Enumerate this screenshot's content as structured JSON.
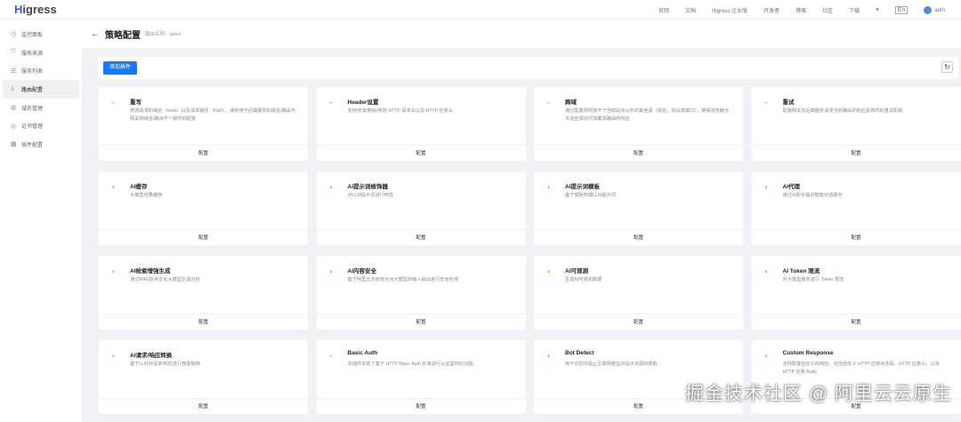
{
  "app": {
    "logo": "Higress"
  },
  "topnav": [
    "官网",
    "文档",
    "Higress 企业版",
    "开发者",
    "博客",
    "社区",
    "下载"
  ],
  "lang": "En",
  "user": "adm",
  "sidebar": [
    {
      "icon": "◷",
      "label": "监控面板"
    },
    {
      "icon": "⤧",
      "label": "服务来源"
    },
    {
      "icon": "☰",
      "label": "服务列表"
    },
    {
      "icon": "⅄",
      "label": "路由配置",
      "active": true
    },
    {
      "icon": "◍",
      "label": "域名管理"
    },
    {
      "icon": "◎",
      "label": "证书管理"
    },
    {
      "icon": "▦",
      "label": "插件配置"
    }
  ],
  "page": {
    "title": "策略配置",
    "subtitle": "路由名称：qwen",
    "add_label": "添加插件",
    "refresh": "↻"
  },
  "cards": [
    {
      "title": "重写",
      "desc": "修改请求的域名（Host）以及请求路径（Path），通常用于后端服务的域名/路由与网关侧域名/路由不一致时的配置",
      "type": "plug"
    },
    {
      "title": "Header设置",
      "desc": "支持增加/删除/修改 HTTP 请求头以及 HTTP 应答头",
      "type": "plug"
    },
    {
      "title": "跨域",
      "desc": "通过配置规则放开了当前站点以外的其他源（域名、协议或端口），使得浏览器允许这些源访问加载该路由的响应",
      "type": "plug"
    },
    {
      "title": "重试",
      "desc": "配置网关向后端服务请求当前路由的响应失败时的重试机制",
      "type": "plug"
    },
    {
      "title": "AI缓存",
      "desc": "大模型结果缓存",
      "type": "ai"
    },
    {
      "title": "AI提示词修饰器",
      "desc": "对LLM提示词进行修改",
      "type": "ai"
    },
    {
      "title": "AI提示词模板",
      "desc": "基于模板构建LLM提示词",
      "type": "ai"
    },
    {
      "title": "AI代理",
      "desc": "通过AI助手提供智能对话服务",
      "type": "ai"
    },
    {
      "title": "AI检索增强生成",
      "desc": "通过RAG技术优化大模型生成内容",
      "type": "ai"
    },
    {
      "title": "AI内容安全",
      "desc": "基于阿里云内容安全对大模型的输入输出进行安全检测",
      "type": "ai"
    },
    {
      "title": "AI可观测",
      "desc": "生成AI可观测数据",
      "type": "ai"
    },
    {
      "title": "AI Token 限流",
      "desc": "对大模型服务进行 Token 限流",
      "type": "ai"
    },
    {
      "title": "AI请求/响应转换",
      "desc": "基于LLM对请求/响应进行智能转换",
      "type": "ai"
    },
    {
      "title": "Basic Auth",
      "desc": "本插件实现了基于 HTTP Basic Auth 标准进行认证鉴权的功能。",
      "type": "plug"
    },
    {
      "title": "Bot Detect",
      "desc": "用于识别并阻止互联网爬虫对站点资源的爬取",
      "type": "ai"
    },
    {
      "title": "Custom Response",
      "desc": "支持配置自定义的响应，包括自定义 HTTP 应答状态码、HTTP 应答头，以及 HTTP 应答 Body",
      "type": "ai"
    }
  ],
  "card_action": "配置",
  "watermark": "掘金技术社区 @ 阿里云云原生"
}
